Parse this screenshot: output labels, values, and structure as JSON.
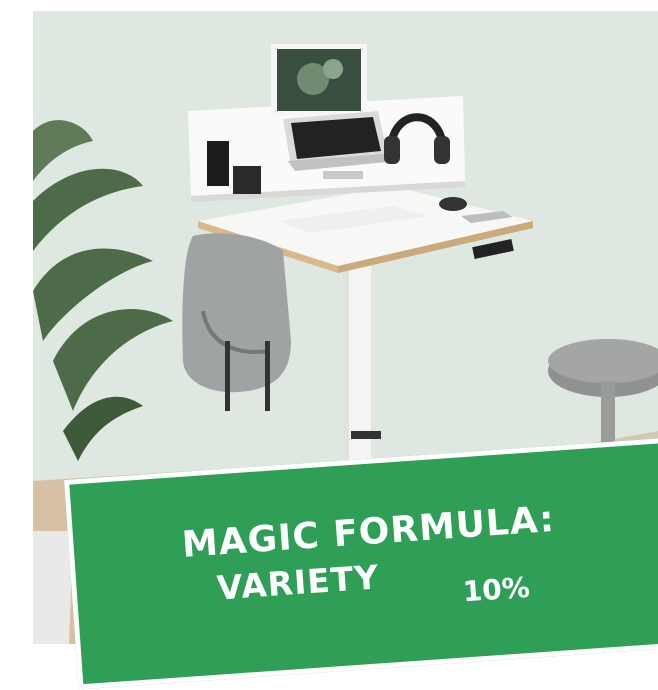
{
  "banner": {
    "line1": "MAGIC FORMULA:",
    "line2": "VARIETY",
    "percent": "10%"
  },
  "colors": {
    "banner_green": "#2f9f58",
    "wall": "#dfe7e1",
    "floor": "#d8c0a2"
  }
}
